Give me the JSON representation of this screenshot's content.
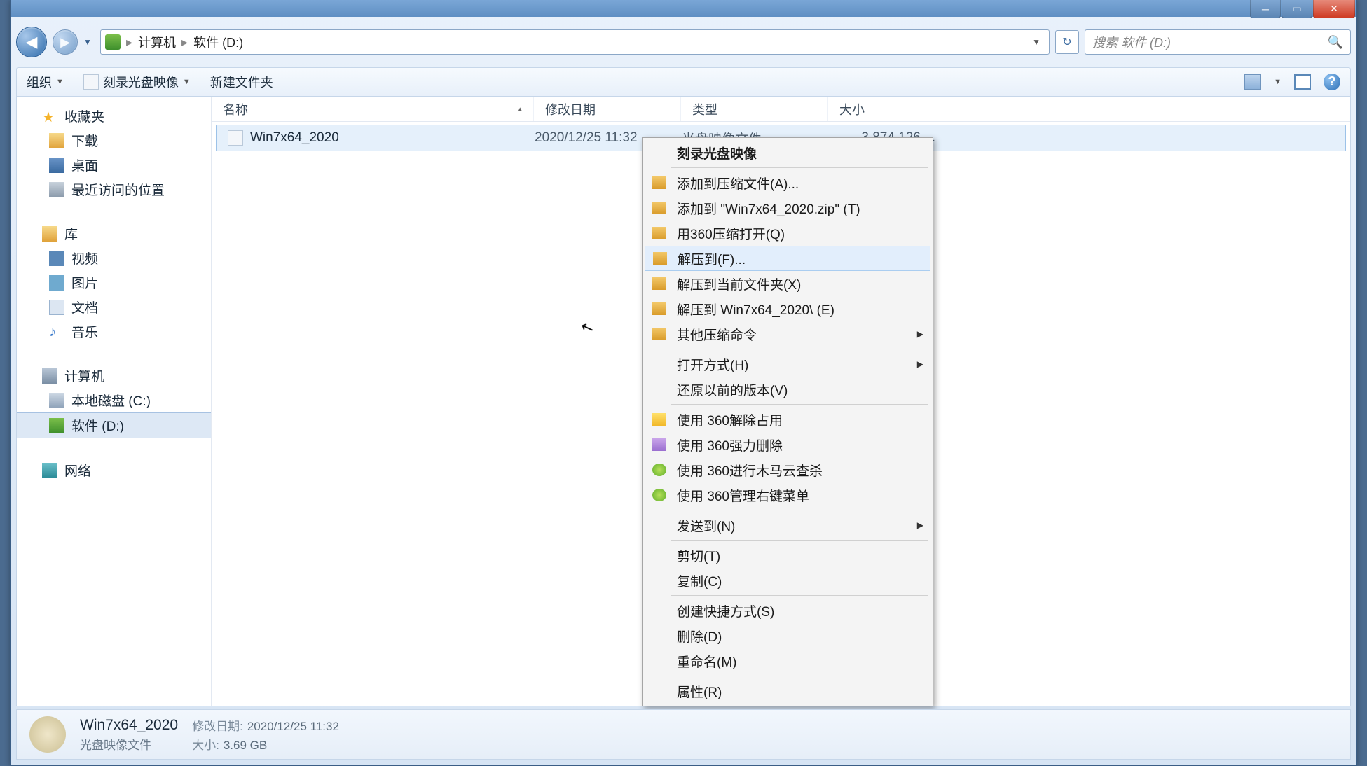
{
  "window": {
    "breadcrumb": {
      "computer": "计算机",
      "drive": "软件 (D:)"
    },
    "search_placeholder": "搜索 软件 (D:)"
  },
  "toolbar": {
    "organize": "组织",
    "burn": "刻录光盘映像",
    "new_folder": "新建文件夹"
  },
  "sidebar": {
    "favorites": "收藏夹",
    "downloads": "下载",
    "desktop": "桌面",
    "recent": "最近访问的位置",
    "libraries": "库",
    "videos": "视频",
    "pictures": "图片",
    "documents": "文档",
    "music": "音乐",
    "computer": "计算机",
    "local_c": "本地磁盘 (C:)",
    "soft_d": "软件 (D:)",
    "network": "网络"
  },
  "columns": {
    "name": "名称",
    "date": "修改日期",
    "type": "类型",
    "size": "大小"
  },
  "file": {
    "name": "Win7x64_2020",
    "date": "2020/12/25 11:32",
    "type": "光盘映像文件",
    "size": "3,874,126 ..."
  },
  "context_menu": {
    "burn_image": "刻录光盘映像",
    "add_to_archive": "添加到压缩文件(A)...",
    "add_to_zip": "添加到 \"Win7x64_2020.zip\" (T)",
    "open_with_360zip": "用360压缩打开(Q)",
    "extract_to": "解压到(F)...",
    "extract_here": "解压到当前文件夹(X)",
    "extract_to_folder": "解压到 Win7x64_2020\\ (E)",
    "other_zip": "其他压缩命令",
    "open_with": "打开方式(H)",
    "restore_prev": "还原以前的版本(V)",
    "unlock_360": "使用 360解除占用",
    "force_del_360": "使用 360强力删除",
    "scan_360": "使用 360进行木马云查杀",
    "manage_menu_360": "使用 360管理右键菜单",
    "send_to": "发送到(N)",
    "cut": "剪切(T)",
    "copy": "复制(C)",
    "shortcut": "创建快捷方式(S)",
    "delete": "删除(D)",
    "rename": "重命名(M)",
    "properties": "属性(R)"
  },
  "statusbar": {
    "title": "Win7x64_2020",
    "subtitle": "光盘映像文件",
    "date_label": "修改日期:",
    "date_value": "2020/12/25 11:32",
    "size_label": "大小:",
    "size_value": "3.69 GB"
  }
}
